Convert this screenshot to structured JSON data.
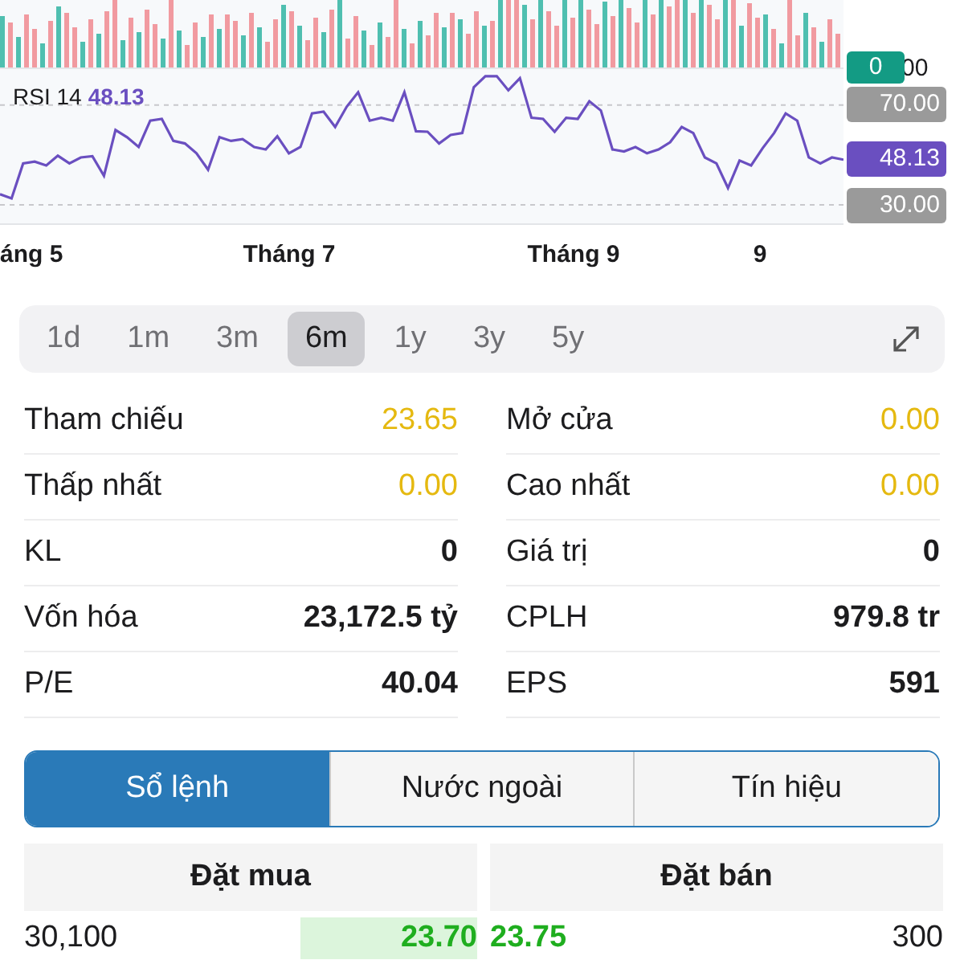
{
  "volume_panel": {
    "last_badge": "0",
    "axis_label": "00"
  },
  "rsi": {
    "chart_data": {
      "type": "line",
      "title": "RSI 14",
      "ylim": [
        22,
        85
      ],
      "yticks": [
        {
          "value": 30,
          "label": "30.00"
        },
        {
          "value": 70,
          "label": "70.00"
        }
      ],
      "series": [
        {
          "color": "#6a4fc0",
          "values": [
            34.3,
            32.6,
            46.6,
            47.3,
            45.8,
            49.7,
            46.6,
            49.0,
            49.5,
            41.7,
            60.0,
            57.1,
            53.2,
            63.7,
            64.4,
            55.6,
            54.6,
            50.7,
            44.1,
            57.1,
            55.6,
            56.3,
            53.2,
            52.2,
            57.5,
            50.7,
            53.2,
            66.6,
            67.3,
            61.2,
            69.3,
            75.1,
            63.7,
            64.9,
            63.7,
            75.1,
            59.5,
            59.3,
            54.6,
            58.0,
            58.8,
            77.1,
            81.5,
            81.5,
            75.9,
            80.7,
            64.9,
            64.4,
            59.3,
            64.9,
            64.4,
            71.5,
            67.8,
            52.2,
            51.4,
            53.2,
            50.7,
            52.2,
            55.1,
            61.2,
            58.8,
            49.0,
            46.6,
            36.8,
            47.8,
            45.8,
            52.7,
            58.8,
            66.6,
            63.7,
            49.0,
            46.6,
            49.0,
            48.1
          ]
        }
      ]
    },
    "legend_value": "48.13",
    "last_value_label": "48.13",
    "x_axis_labels": [
      "áng 5",
      "Tháng 7",
      "Tháng 9",
      "9"
    ]
  },
  "periods": [
    {
      "label": "1d",
      "selected": false
    },
    {
      "label": "1m",
      "selected": false
    },
    {
      "label": "3m",
      "selected": false
    },
    {
      "label": "6m",
      "selected": true
    },
    {
      "label": "1y",
      "selected": false
    },
    {
      "label": "3y",
      "selected": false
    },
    {
      "label": "5y",
      "selected": false
    }
  ],
  "stats": [
    [
      {
        "label": "Tham chiếu",
        "value": "23.65",
        "kind": "price"
      },
      {
        "label": "Mở cửa",
        "value": "0.00",
        "kind": "price"
      }
    ],
    [
      {
        "label": "Thấp nhất",
        "value": "0.00",
        "kind": "price"
      },
      {
        "label": "Cao nhất",
        "value": "0.00",
        "kind": "price"
      }
    ],
    [
      {
        "label": "KL",
        "value": "0",
        "kind": "number"
      },
      {
        "label": "Giá trị",
        "value": "0",
        "kind": "number"
      }
    ],
    [
      {
        "label": "Vốn hóa",
        "value": "23,172.5 tỷ",
        "kind": "number"
      },
      {
        "label": "CPLH",
        "value": "979.8 tr",
        "kind": "number"
      }
    ],
    [
      {
        "label": "P/E",
        "value": "40.04",
        "kind": "number"
      },
      {
        "label": "EPS",
        "value": "591",
        "kind": "number"
      }
    ]
  ],
  "tabs": [
    {
      "label": "Sổ lệnh",
      "selected": true
    },
    {
      "label": "Nước ngoài",
      "selected": false
    },
    {
      "label": "Tín hiệu",
      "selected": false
    }
  ],
  "order_book": {
    "headers": [
      "Đặt mua",
      "Đặt bán"
    ],
    "rows": [
      {
        "bid_volume": "30,100",
        "bid_price": "23.70",
        "ask_price": "23.75",
        "ask_volume": "300"
      }
    ]
  }
}
